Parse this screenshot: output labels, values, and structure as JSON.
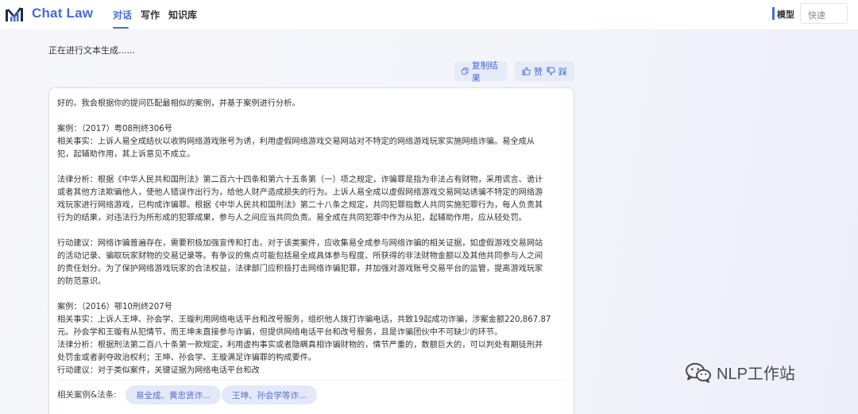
{
  "header": {
    "brand": "Chat Law",
    "tabs": [
      {
        "label": "对话",
        "active": true
      },
      {
        "label": "写作",
        "active": false
      },
      {
        "label": "知识库",
        "active": false
      }
    ],
    "model_label": "模型",
    "model_value": "快速"
  },
  "status_text": "正在进行文本生成......",
  "actions": {
    "copy_label": "复制结果",
    "like_label": "赞",
    "dislike_label": "踩"
  },
  "result": {
    "lines": [
      "好的。我会根据你的提问匹配最相似的案例，并基于案例进行分析。",
      "",
      "案例：（2017）粤08刑终306号",
      "相关事实：上诉人易全成结伙以收购网络游戏账号为诱，利用虚假网络游戏交易网站对不特定的网络游戏玩家实施网络诈骗。易全成从",
      "犯，起辅助作用，其上诉意见不成立。",
      "",
      "法律分析：根据《中华人民共和国刑法》第二百六十四条和第六十五条第（一）项之规定，诈骗罪是指为非法占有财物，采用谎言、诡计",
      "或者其他方法欺骗他人，使他人错误作出行为，给他人财产造成损失的行为。上诉人易全成以虚假网络游戏交易网站诱骗不特定的网络游",
      "戏玩家进行网络游戏，已构成诈骗罪。根据《中华人民共和国刑法》第二十八条之规定，共同犯罪指数人共同实施犯罪行为，每人负责其",
      "行为的结果，对违法行为所形成的犯罪成果，参与人之间应当共同负责。易全成在共同犯罪中作为从犯，起辅助作用，应从轻处罚。",
      "",
      "行动建议：网络诈骗普遍存在，需要积极加强宣传和打击。对于该类案件，应收集易全成参与网络诈骗的相关证据，如虚假游戏交易网站",
      "的活动记录、骗取玩家财物的交易记录等。有争议的焦点可能包括易全成具体参与程度、所获得的非法财物金额以及其他共同参与人之间",
      "的责任划分。为了保护网络游戏玩家的合法权益，法律部门应积极打击网络诈骗犯罪，并加强对游戏账号交易平台的监管，提高游戏玩家",
      "的防范意识。",
      "",
      "案例：（2016）鄂10刑终207号",
      "相关事实：上诉人王坤、孙会学、王璇利用网络电话平台和改号服务，组织他人拨打诈骗电话，共致19起成功诈骗，涉案金额220,867.87",
      "元。孙会学和王璇有从犯情节，而王坤未直接参与诈骗，但提供网络电话平台和改号服务，且是诈骗团伙中不可缺少的环节。",
      "法律分析：根据刑法第二百八十条第一款规定，利用虚构事实或者隐瞒真相诈骗财物的，情节严重的，数额巨大的，可以判处有期徒刑并",
      "处罚金或者剥夺政治权利；王坤、孙会学、王璇满足诈骗罪的构成要件。",
      "行动建议：对于类似案件，关键证据为网络电话平台和改"
    ]
  },
  "related": {
    "label": "相关案例&法条:",
    "chips": [
      "易全成、黄忠贤诈...",
      "王坤、孙会学等诈..."
    ]
  },
  "watermark": "NLP工作站",
  "colors": {
    "accent": "#4a6bd8",
    "pill_bg": "#e6ebf8",
    "chip_bg": "#e3e9f8"
  }
}
